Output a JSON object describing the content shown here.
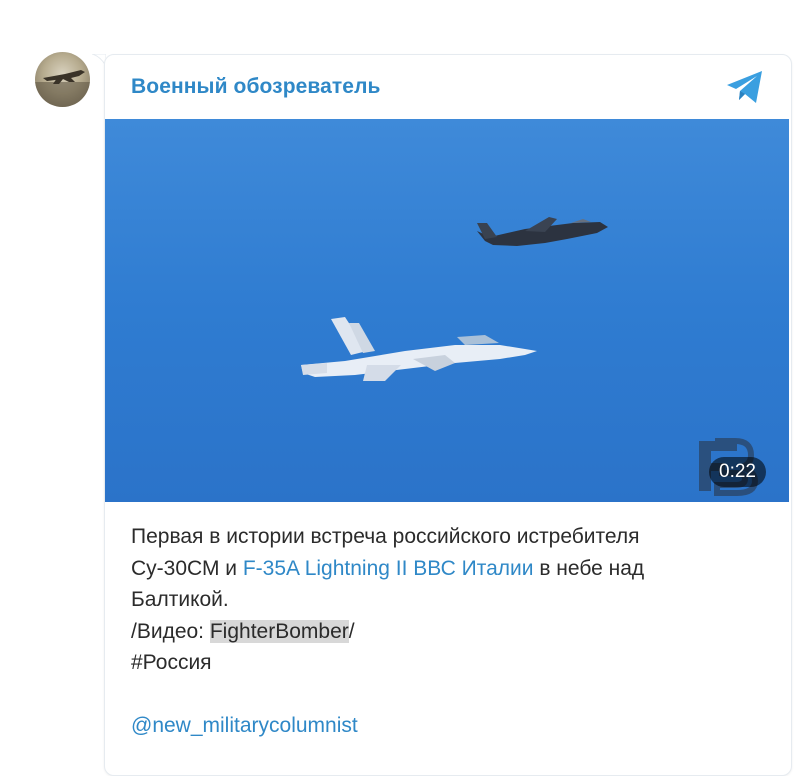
{
  "channel": {
    "name": "Военный обозреватель",
    "avatar": "channel-avatar-fighter-jet",
    "source_icon": "telegram-plane-icon"
  },
  "media": {
    "type": "video",
    "duration": "0:22",
    "watermark": "FB"
  },
  "post": {
    "line1": "Первая в истории встреча российского истребителя",
    "line2_prefix": "Су-30СМ и ",
    "line2_link": "F-35A Lightning II ВВС Италии",
    "line2_suffix": " в небе над",
    "line3": "Балтикой.",
    "line4_prefix": "/Видео: ",
    "line4_highlight": "FighterBomber",
    "line4_suffix": "/",
    "hashtag": "#Россия",
    "mention": "@new_militarycolumnist"
  },
  "colors": {
    "link": "#2f88c7",
    "sky": "#2e7ad0",
    "text": "#2b2b2b"
  }
}
